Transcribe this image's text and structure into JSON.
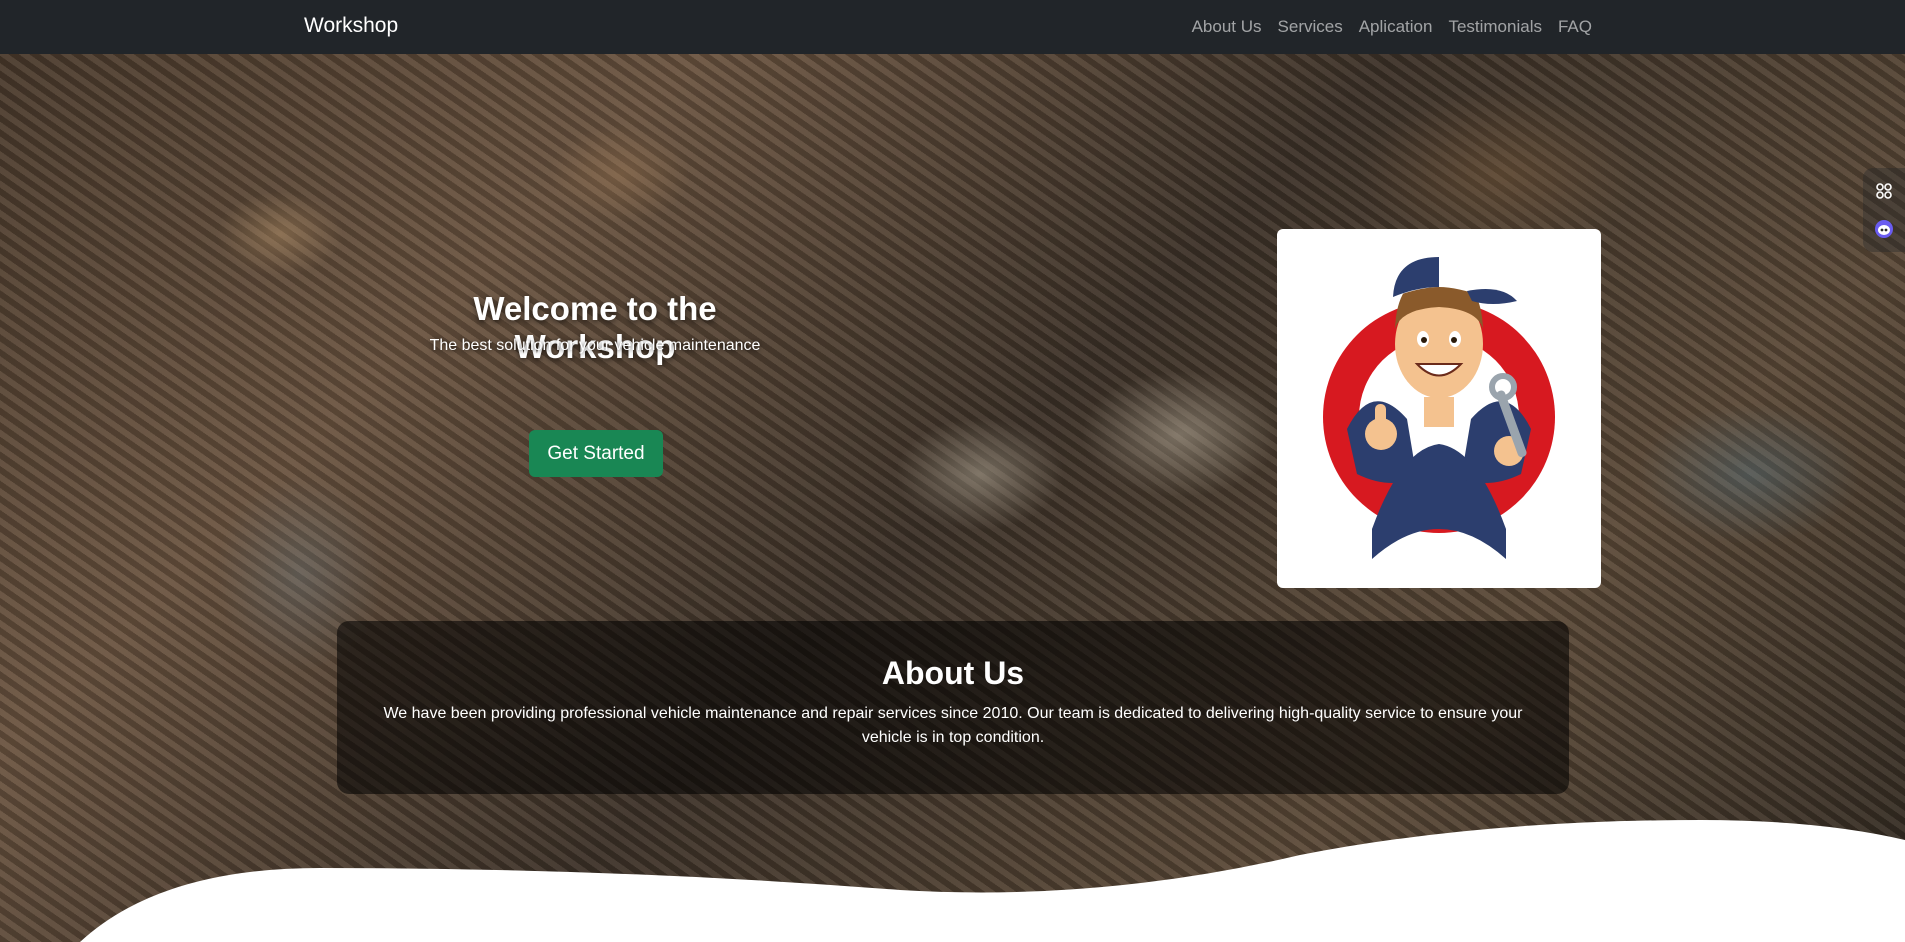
{
  "navbar": {
    "brand": "Workshop",
    "links": [
      {
        "label": "About Us"
      },
      {
        "label": "Services"
      },
      {
        "label": "Aplication"
      },
      {
        "label": "Testimonials"
      },
      {
        "label": "FAQ"
      }
    ]
  },
  "hero": {
    "title": "Welcome to the Workshop",
    "subtitle": "The best solution for your vehicle maintenance",
    "cta_label": "Get Started",
    "image_icon": "mechanic-mascot-icon"
  },
  "about": {
    "title": "About Us",
    "text": "We have been providing professional vehicle maintenance and repair services since 2010. Our team is dedicated to delivering high-quality service to ensure your vehicle is in top condition."
  },
  "side_tools": {
    "icons": [
      "grid-icon",
      "assistant-icon"
    ]
  },
  "colors": {
    "navbar_bg": "#212529",
    "cta_bg": "#198754",
    "mascot_red": "#d71920",
    "mascot_shirt": "#2c3e6e"
  }
}
